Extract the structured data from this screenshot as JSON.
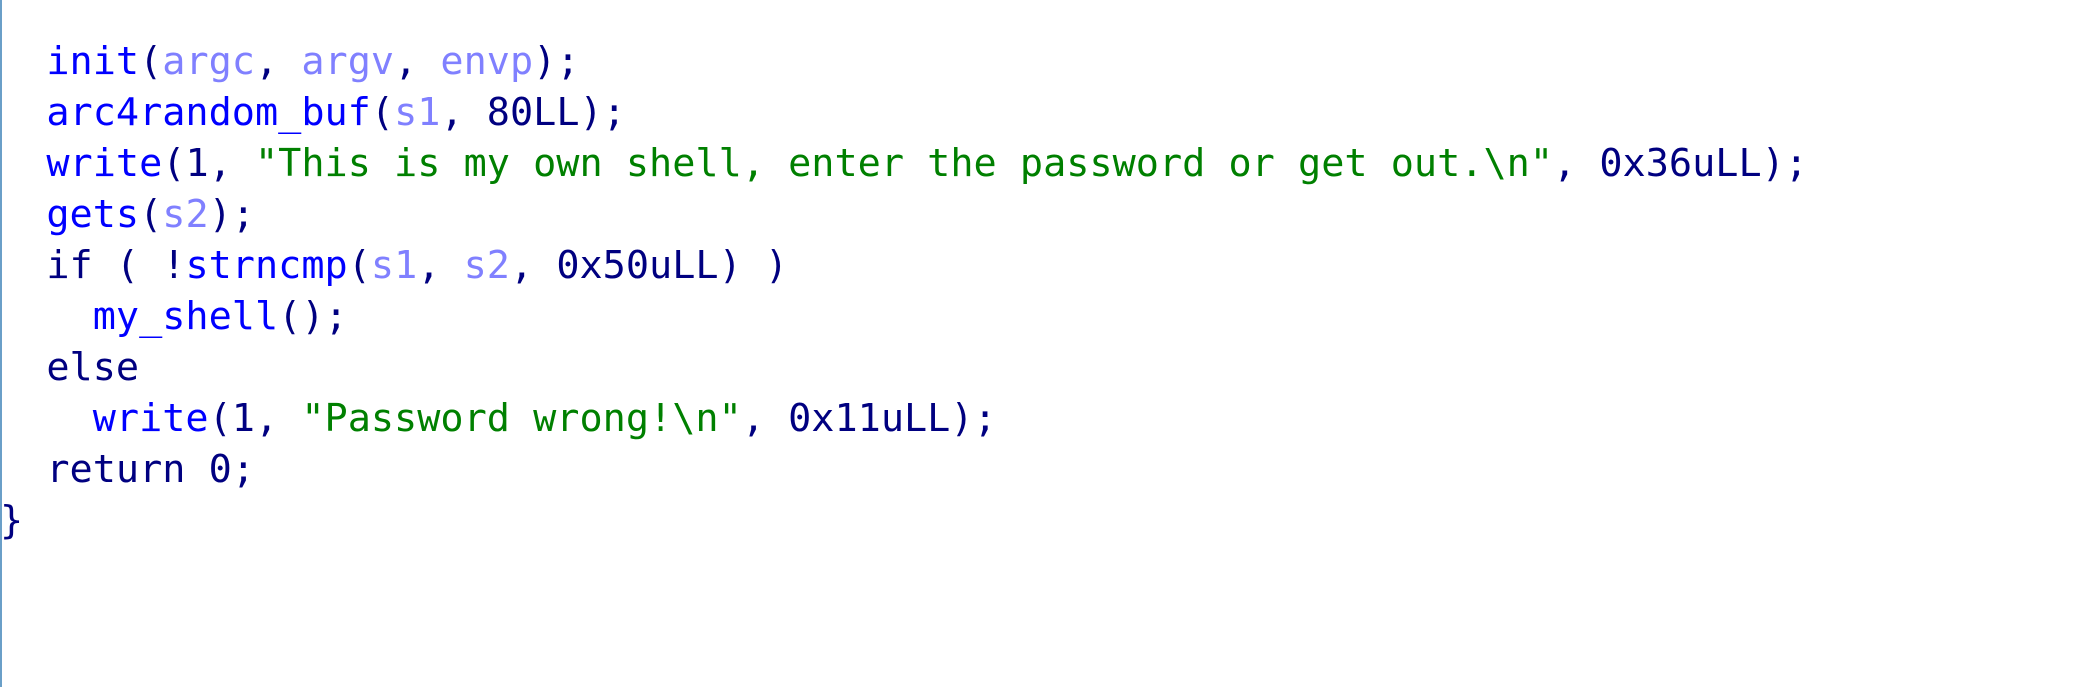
{
  "colors": {
    "function": "#0000ff",
    "variable": "#8080ff",
    "string": "#008000",
    "plain": "#000080",
    "gutter_line": "#6a9fc8"
  },
  "lines": [
    {
      "indent": "  ",
      "tokens": [
        {
          "t": "func",
          "s": "init"
        },
        {
          "t": "plain",
          "s": "("
        },
        {
          "t": "var",
          "s": "argc"
        },
        {
          "t": "plain",
          "s": ", "
        },
        {
          "t": "var",
          "s": "argv"
        },
        {
          "t": "plain",
          "s": ", "
        },
        {
          "t": "var",
          "s": "envp"
        },
        {
          "t": "plain",
          "s": ");"
        }
      ]
    },
    {
      "indent": "  ",
      "tokens": [
        {
          "t": "func",
          "s": "arc4random_buf"
        },
        {
          "t": "plain",
          "s": "("
        },
        {
          "t": "var",
          "s": "s1"
        },
        {
          "t": "plain",
          "s": ", 80LL);"
        }
      ]
    },
    {
      "indent": "  ",
      "tokens": [
        {
          "t": "func",
          "s": "write"
        },
        {
          "t": "plain",
          "s": "(1, "
        },
        {
          "t": "str",
          "s": "\"This is my own shell, enter the password or get out.\\n\""
        },
        {
          "t": "plain",
          "s": ", 0x36uLL);"
        }
      ]
    },
    {
      "indent": "  ",
      "tokens": [
        {
          "t": "func",
          "s": "gets"
        },
        {
          "t": "plain",
          "s": "("
        },
        {
          "t": "var",
          "s": "s2"
        },
        {
          "t": "plain",
          "s": ");"
        }
      ]
    },
    {
      "indent": "  ",
      "tokens": [
        {
          "t": "plain",
          "s": "if ( !"
        },
        {
          "t": "func",
          "s": "strncmp"
        },
        {
          "t": "plain",
          "s": "("
        },
        {
          "t": "var",
          "s": "s1"
        },
        {
          "t": "plain",
          "s": ", "
        },
        {
          "t": "var",
          "s": "s2"
        },
        {
          "t": "plain",
          "s": ", 0x50uLL) )"
        }
      ]
    },
    {
      "indent": "    ",
      "tokens": [
        {
          "t": "func",
          "s": "my_shell"
        },
        {
          "t": "plain",
          "s": "();"
        }
      ]
    },
    {
      "indent": "  ",
      "tokens": [
        {
          "t": "plain",
          "s": "else"
        }
      ]
    },
    {
      "indent": "    ",
      "tokens": [
        {
          "t": "func",
          "s": "write"
        },
        {
          "t": "plain",
          "s": "(1, "
        },
        {
          "t": "str",
          "s": "\"Password wrong!\\n\""
        },
        {
          "t": "plain",
          "s": ", 0x11uLL);"
        }
      ]
    },
    {
      "indent": "  ",
      "tokens": [
        {
          "t": "plain",
          "s": "return 0;"
        }
      ]
    },
    {
      "indent": "",
      "tokens": [
        {
          "t": "plain",
          "s": "}"
        }
      ]
    }
  ]
}
